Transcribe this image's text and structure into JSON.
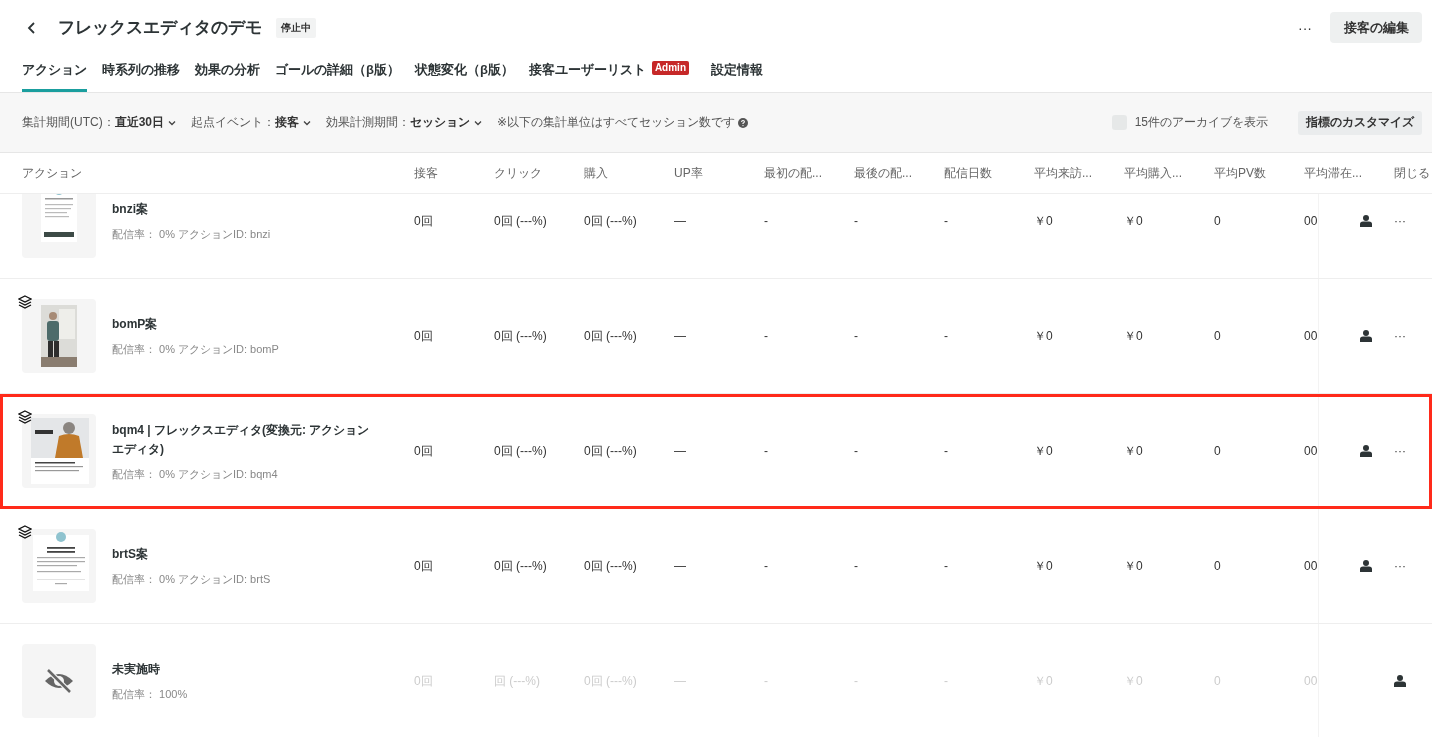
{
  "header": {
    "title": "フレックスエディタのデモ",
    "status": "停止中",
    "edit_button": "接客の編集",
    "more": "···"
  },
  "tabs": [
    {
      "label": "アクション",
      "selected": true
    },
    {
      "label": "時系列の推移",
      "selected": false
    },
    {
      "label": "効果の分析",
      "selected": false
    },
    {
      "label": "ゴールの詳細（β版）",
      "selected": false
    },
    {
      "label": "状態変化（β版）",
      "selected": false
    },
    {
      "label": "接客ユーザーリスト",
      "selected": false,
      "badge": "Admin"
    },
    {
      "label": "設定情報",
      "selected": false
    }
  ],
  "filters": [
    {
      "text": "集計期間(UTC)：**直近30日**"
    },
    {
      "text": "起点イベント：**接客**"
    },
    {
      "text": "効果計測期間：**セッション**"
    }
  ],
  "note": "※以下の集計単位はすべてセッション数です",
  "archive": {
    "label": "15件のアーカイブを表示",
    "checked": false
  },
  "customize_button": "指標のカスタマイズ",
  "table": {
    "action_column": "アクション",
    "columns": [
      "接客",
      "クリック",
      "購入",
      "UP率",
      "最初の配...",
      "最後の配...",
      "配信日数",
      "平均来訪...",
      "平均購入...",
      "平均PV数",
      "平均滞在...",
      "閉じる"
    ],
    "rows": [
      {
        "title": "bnzi案",
        "meta": "配信率： 0% アクションID: bnzi",
        "thumbnail": {
          "kind": "picture"
        },
        "layers": false,
        "selected": false,
        "disabled": false,
        "menu": true,
        "cells": [
          "0回",
          "0回 (---%)",
          "0回 (---%)",
          "—",
          "-",
          "-",
          "-",
          "￥0",
          "￥0",
          "0",
          "00"
        ]
      },
      {
        "title": "bomP案",
        "meta": "配信率： 0% アクションID: bomP",
        "thumbnail": {
          "kind": "picture"
        },
        "layers": true,
        "selected": false,
        "disabled": false,
        "menu": true,
        "cells": [
          "0回",
          "0回 (---%)",
          "0回 (---%)",
          "—",
          "-",
          "-",
          "-",
          "￥0",
          "￥0",
          "0",
          "00"
        ]
      },
      {
        "title": "bqm4 | フレックスエディタ(変換元: アクションエディタ)",
        "meta": "配信率： 0% アクションID: bqm4",
        "thumbnail": {
          "kind": "picture"
        },
        "layers": true,
        "selected": true,
        "disabled": false,
        "menu": true,
        "cells": [
          "0回",
          "0回 (---%)",
          "0回 (---%)",
          "—",
          "-",
          "-",
          "-",
          "￥0",
          "￥0",
          "0",
          "00"
        ]
      },
      {
        "title": "brtS案",
        "meta": "配信率： 0% アクションID: brtS",
        "thumbnail": {
          "kind": "picture"
        },
        "layers": true,
        "selected": false,
        "disabled": false,
        "menu": true,
        "cells": [
          "0回",
          "0回 (---%)",
          "0回 (---%)",
          "—",
          "-",
          "-",
          "-",
          "￥0",
          "￥0",
          "0",
          "00"
        ]
      },
      {
        "title": "未実施時",
        "meta": "配信率： 100%",
        "thumbnail": {
          "kind": "icon"
        },
        "layers": false,
        "selected": false,
        "disabled": true,
        "menu": false,
        "cells": [
          "0回",
          "回 (---%)",
          "0回 (---%)",
          "—",
          "-",
          "-",
          "-",
          "￥0",
          "￥0",
          "0",
          "00"
        ]
      }
    ]
  }
}
